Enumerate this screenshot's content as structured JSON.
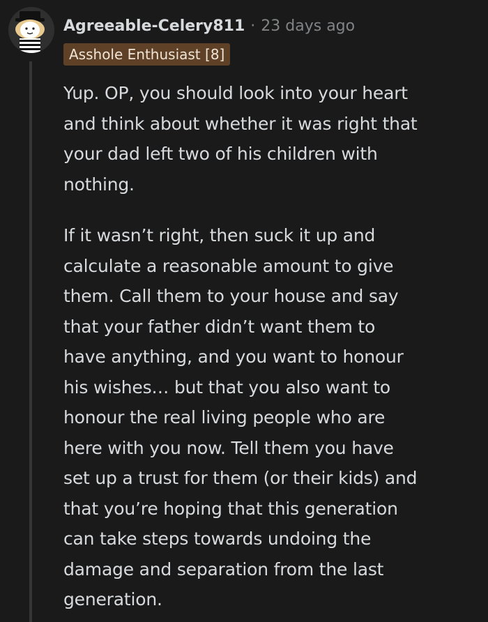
{
  "comment": {
    "author": "Agreeable-Celery811",
    "separator": "·",
    "timestamp": "23 days ago",
    "flair": "Asshole Enthusiast [8]",
    "avatar_icon": "user-avatar-icon",
    "paragraphs": [
      {
        "lines": [
          "Yup. OP, you should look into your heart",
          "and think about whether it was right that",
          "your dad left two of his children with",
          "nothing."
        ]
      },
      {
        "lines": [
          "If it wasn’t right, then suck it up and",
          "calculate a reasonable amount to give",
          "them. Call them to your house and say",
          "that your father didn’t want them to",
          "have anything, and you want to honour",
          "his wishes… but that you also want to",
          "honour the real living people who are",
          "here with you now. Tell them you have",
          "set up a trust for them (or their kids) and",
          "that you’re hoping that this generation",
          "can take steps towards undoing the",
          "damage and separation from the last",
          "generation."
        ]
      }
    ]
  },
  "colors": {
    "background": "#1a1a1b",
    "text": "#d7dadc",
    "muted": "#818384",
    "flair_bg": "#5e4127",
    "thread_line": "#343536"
  }
}
